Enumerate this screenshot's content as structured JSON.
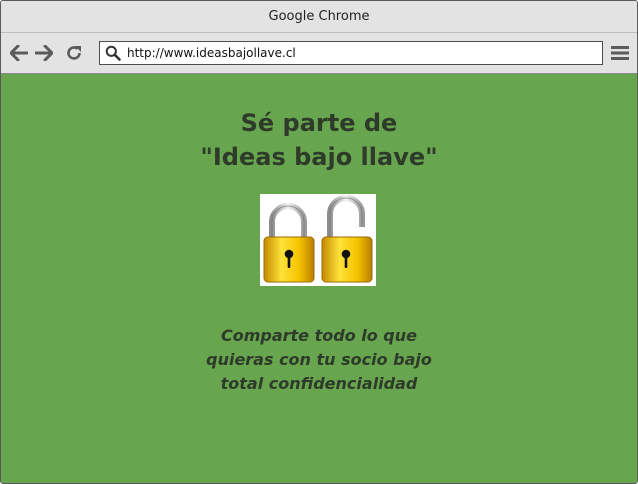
{
  "window": {
    "title": "Google Chrome"
  },
  "toolbar": {
    "back_icon": "arrow-left-icon",
    "forward_icon": "arrow-right-icon",
    "reload_icon": "reload-icon",
    "search_icon": "search-icon",
    "menu_icon": "hamburger-menu-icon",
    "url": "http://www.ideasbajollave.cl"
  },
  "page": {
    "background": "#67a54e",
    "text_color": "#2f3b2a",
    "headline_lines": [
      "Sé parte de",
      "\"Ideas bajo llave\""
    ],
    "image": {
      "icon": "padlock-icon",
      "count": 2,
      "color": "#f5c400"
    },
    "tagline_lines": [
      "Comparte todo lo que",
      "quieras con tu socio bajo",
      "total confidencialidad"
    ]
  }
}
